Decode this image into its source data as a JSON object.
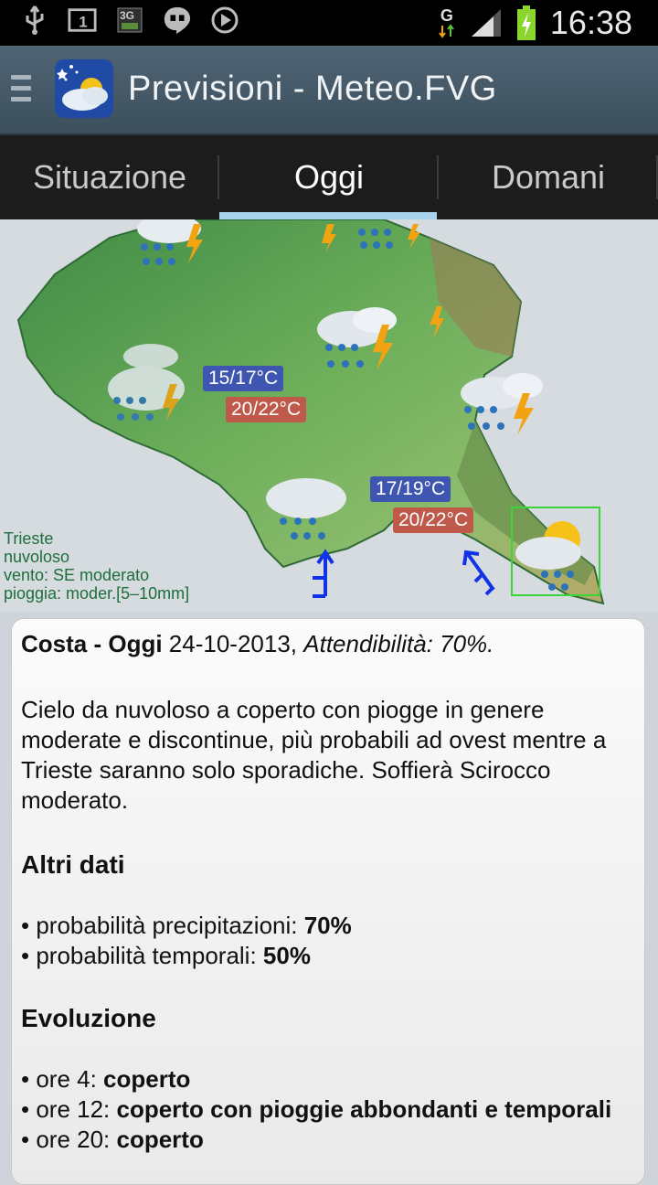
{
  "status_bar": {
    "time": "16:38",
    "network": "G",
    "icons_left": [
      "usb-icon",
      "notification-1-icon",
      "3g-icon",
      "hangouts-icon",
      "play-icon"
    ]
  },
  "app": {
    "title": "Previsioni - Meteo.FVG"
  },
  "tabs": [
    {
      "label": "Situazione",
      "selected": false
    },
    {
      "label": "Oggi",
      "selected": true
    },
    {
      "label": "Domani",
      "selected": false
    }
  ],
  "map": {
    "temps": [
      {
        "min": "15/17°C",
        "max": "20/22°C"
      },
      {
        "min": "17/19°C",
        "max": "20/22°C"
      }
    ],
    "info": {
      "city": "Trieste",
      "sky": "nuvoloso",
      "wind": "vento: SE moderato",
      "rain": "pioggia: moder.[5–10mm]"
    }
  },
  "forecast": {
    "zone_label": "Costa - Oggi",
    "date": "24-10-2013,",
    "reliability": "Attendibilità: 70%.",
    "description": "Cielo da nuvoloso a coperto con piogge in genere moderate e discontinue, più probabili ad ovest mentre a Trieste saranno solo sporadiche. Soffierà Scirocco moderato.",
    "altri_dati": {
      "heading": "Altri dati",
      "items": [
        {
          "label": "• probabilità precipitazioni: ",
          "value": "70%"
        },
        {
          "label": "• probabilità temporali: ",
          "value": "50%"
        }
      ]
    },
    "evoluzione": {
      "heading": "Evoluzione",
      "items": [
        {
          "label": "• ore 4: ",
          "value": "coperto"
        },
        {
          "label": "• ore 12: ",
          "value": "coperto con pioggie abbondanti e temporali"
        },
        {
          "label": "• ore 20: ",
          "value": "coperto"
        }
      ]
    }
  }
}
